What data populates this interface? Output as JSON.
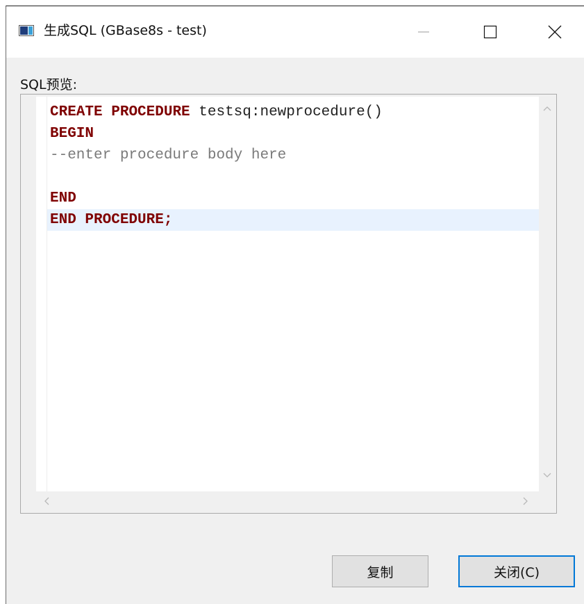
{
  "window": {
    "title": "生成SQL (GBase8s - test)",
    "icon": "app-window-icon",
    "controls": [
      "minimize-icon",
      "maximize-icon",
      "close-icon"
    ]
  },
  "preview": {
    "label": "SQL预览:",
    "lines": [
      [
        {
          "t": "CREATE",
          "c": "kw"
        },
        {
          "t": " ",
          "c": "plain"
        },
        {
          "t": "PROCEDURE",
          "c": "kw"
        },
        {
          "t": " testsq:newprocedure()",
          "c": "plain"
        }
      ],
      [
        {
          "t": "BEGIN",
          "c": "kw"
        }
      ],
      [
        {
          "t": "--enter procedure body here",
          "c": "comment"
        }
      ],
      [],
      [
        {
          "t": "END",
          "c": "kw"
        }
      ],
      [
        {
          "t": "END",
          "c": "kw"
        },
        {
          "t": " ",
          "c": "plain"
        },
        {
          "t": "PROCEDURE;",
          "c": "kw"
        }
      ]
    ],
    "current_line": 6
  },
  "buttons": {
    "copy": "复制",
    "close": "关闭(C)"
  },
  "colors": {
    "keyword": "#7f0000",
    "comment": "#7a7a7a",
    "current_line_bg": "#e8f2fe",
    "focus_border": "#0078d7"
  }
}
